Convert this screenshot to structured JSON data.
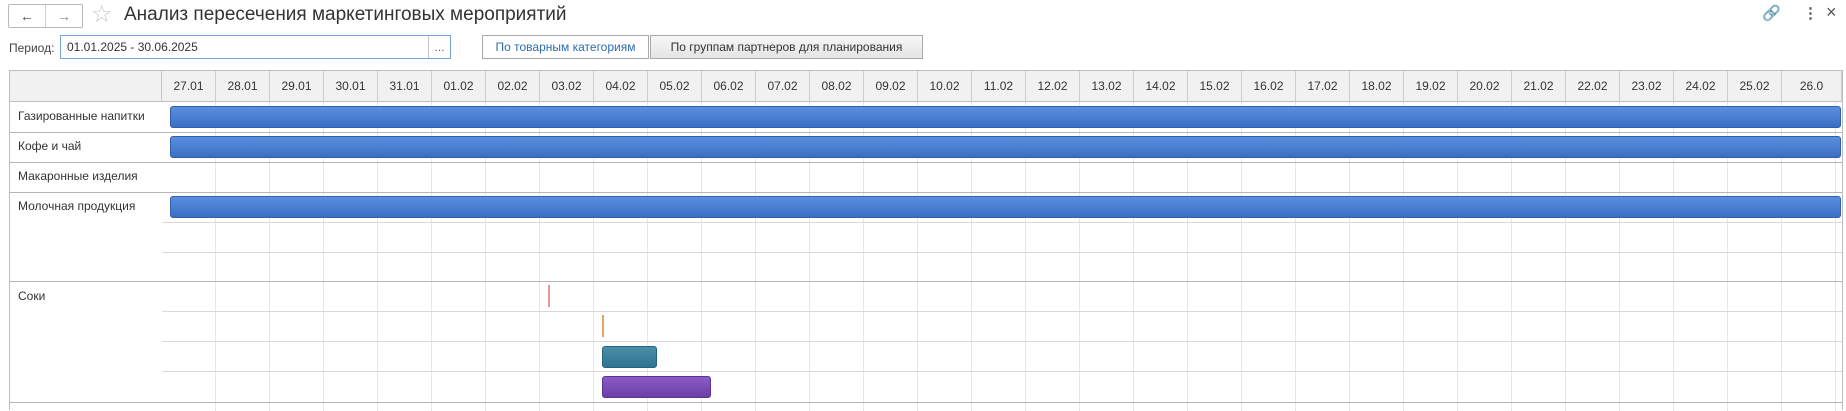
{
  "window": {
    "title": "Анализ пересечения маркетинговых мероприятий",
    "back_icon": "←",
    "forward_icon": "→",
    "star_icon": "☆",
    "link_icon": "🔗",
    "more_icon": "⋮",
    "close_icon": "×"
  },
  "filter": {
    "period_label": "Период:",
    "period_value": "01.01.2025 - 30.06.2025",
    "choose_label": "..."
  },
  "tabs": [
    {
      "label": "По товарным категориям",
      "active": true
    },
    {
      "label": "По группам партнеров для планирования",
      "active": false
    }
  ],
  "gantt": {
    "dates": [
      "27.01",
      "28.01",
      "29.01",
      "30.01",
      "31.01",
      "01.02",
      "02.02",
      "03.02",
      "04.02",
      "05.02",
      "06.02",
      "07.02",
      "08.02",
      "09.02",
      "10.02",
      "11.02",
      "12.02",
      "13.02",
      "14.02",
      "15.02",
      "16.02",
      "17.02",
      "18.02",
      "19.02",
      "20.02",
      "21.02",
      "22.02",
      "23.02",
      "24.02",
      "25.02",
      "26.0"
    ],
    "rows": [
      {
        "label": "Газированные напитки"
      },
      {
        "label": "Кофе и чай"
      },
      {
        "label": "Макаронные изделия"
      },
      {
        "label": "Молочная продукция"
      },
      {
        "label": "Соки"
      }
    ],
    "colors": {
      "blue": "#3f74c9",
      "teal": "#2f7390",
      "purple": "#6c3fa8",
      "red_marker": "#e59a9a",
      "orange_marker": "#e6a36a"
    }
  }
}
